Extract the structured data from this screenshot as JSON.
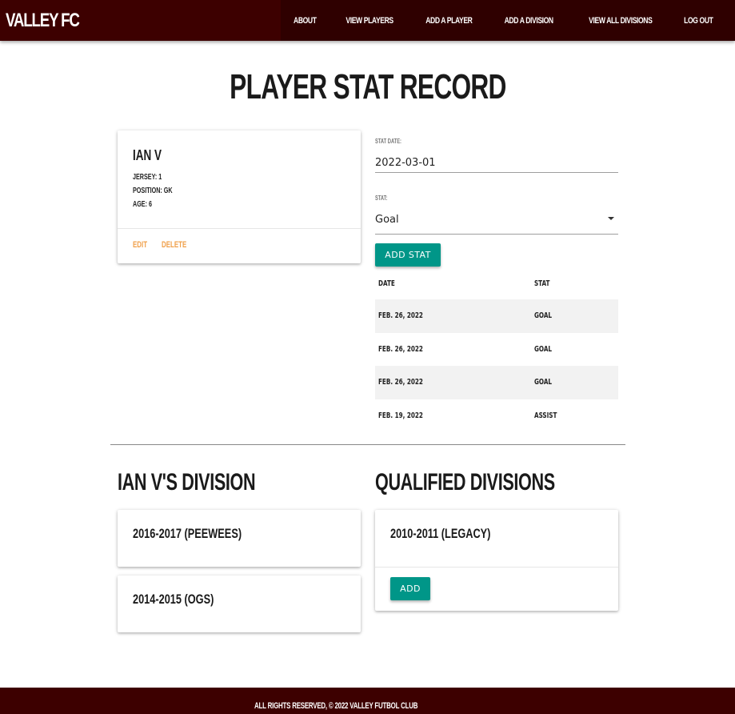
{
  "nav": {
    "brand": "VALLEY FC",
    "links": [
      "ABOUT",
      "VIEW PLAYERS",
      "ADD A PLAYER",
      "ADD A DIVISION",
      "VIEW ALL DIVISIONS",
      "LOG OUT"
    ]
  },
  "page_title": "PLAYER STAT RECORD",
  "player": {
    "name": "IAN V",
    "jersey": "JERSEY: 1",
    "position": "POSITION: GK",
    "age": "AGE: 6",
    "edit_label": "EDIT",
    "delete_label": "DELETE"
  },
  "stat_form": {
    "date_label": "STAT DATE:",
    "date_value": "2022-03-01",
    "stat_label": "STAT:",
    "stat_value": "Goal",
    "add_button": "ADD STAT"
  },
  "stat_table": {
    "headers": [
      "DATE",
      "STAT"
    ],
    "rows": [
      [
        "FEB. 26, 2022",
        "GOAL"
      ],
      [
        "FEB. 26, 2022",
        "GOAL"
      ],
      [
        "FEB. 26, 2022",
        "GOAL"
      ],
      [
        "FEB. 19, 2022",
        "ASSIST"
      ]
    ]
  },
  "player_divisions": {
    "title": "IAN V'S DIVISION",
    "items": [
      "2016-2017 (PEEWEES)",
      "2014-2015 (OGS)"
    ]
  },
  "qualified_divisions": {
    "title": "QUALIFIED DIVISIONS",
    "items": [
      {
        "name": "2010-2011 (LEGACY)",
        "button": "ADD"
      }
    ]
  },
  "footer": {
    "text": "ALL RIGHTS RESERVED, © 2022 VALLEY FUTBOL CLUB"
  },
  "colors": {
    "nav_bg": "#3d0000",
    "accent_teal": "#009688",
    "action_orange": "#f0a04a"
  }
}
